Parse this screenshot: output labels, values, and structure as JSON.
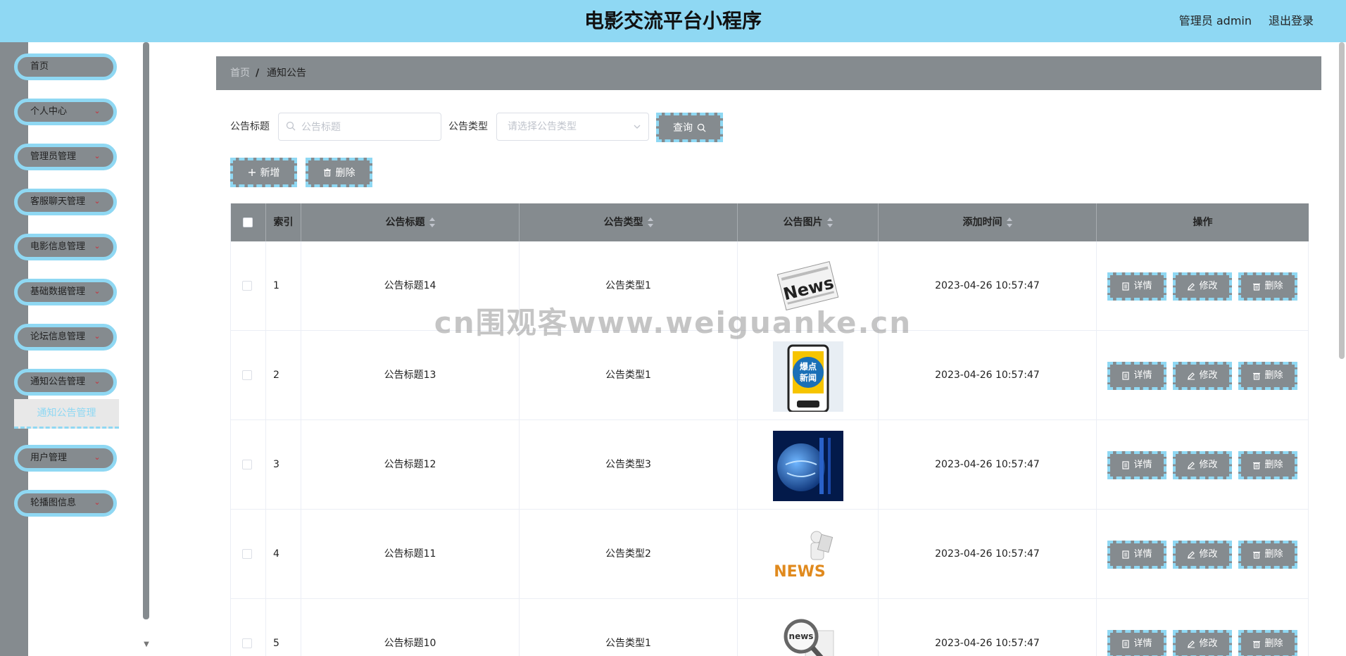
{
  "header": {
    "title": "电影交流平台小程序",
    "user": "管理员 admin",
    "logout": "退出登录"
  },
  "sidebar": {
    "items": [
      {
        "label": "首页",
        "has_chevron": false
      },
      {
        "label": "个人中心",
        "has_chevron": true
      },
      {
        "label": "管理员管理",
        "has_chevron": true
      },
      {
        "label": "客服聊天管理",
        "has_chevron": true
      },
      {
        "label": "电影信息管理",
        "has_chevron": true
      },
      {
        "label": "基础数据管理",
        "has_chevron": true
      },
      {
        "label": "论坛信息管理",
        "has_chevron": true
      },
      {
        "label": "通知公告管理",
        "has_chevron": true
      },
      {
        "label": "用户管理",
        "has_chevron": true
      },
      {
        "label": "轮播图信息",
        "has_chevron": true
      }
    ],
    "active_sub": "通知公告管理"
  },
  "breadcrumb": {
    "home": "首页",
    "separator": "/",
    "current": "通知公告"
  },
  "search": {
    "title_label": "公告标题",
    "title_placeholder": "公告标题",
    "type_label": "公告类型",
    "type_placeholder": "请选择公告类型",
    "query_button": "查询"
  },
  "actions": {
    "add": "新增",
    "delete": "删除"
  },
  "table": {
    "columns": [
      "索引",
      "公告标题",
      "公告类型",
      "公告图片",
      "添加时间",
      "操作"
    ],
    "rows": [
      {
        "index": "1",
        "title": "公告标题14",
        "type": "公告类型1",
        "image": "news-newspaper-image",
        "time": "2023-04-26 10:57:47"
      },
      {
        "index": "2",
        "title": "公告标题13",
        "type": "公告类型1",
        "image": "breaking-news-phone-image",
        "time": "2023-04-26 10:57:47"
      },
      {
        "index": "3",
        "title": "公告标题12",
        "type": "公告类型3",
        "image": "globe-news-image",
        "time": "2023-04-26 10:57:47"
      },
      {
        "index": "4",
        "title": "公告标题11",
        "type": "公告类型2",
        "image": "news-figure-image",
        "time": "2023-04-26 10:57:47"
      },
      {
        "index": "5",
        "title": "公告标题10",
        "type": "公告类型1",
        "image": "magnifier-news-image",
        "time": "2023-04-26 10:57:47"
      }
    ],
    "row_actions": {
      "detail": "详情",
      "edit": "修改",
      "delete": "删除"
    }
  },
  "watermark": "cn围观客www.weiguanke.cn",
  "colors": {
    "header_bg": "#8fd8f3",
    "sidebar_bg": "#858b8f",
    "accent_border": "#8fd8f3",
    "button_bg": "#858b8f",
    "danger_chevron": "#c8303a"
  }
}
